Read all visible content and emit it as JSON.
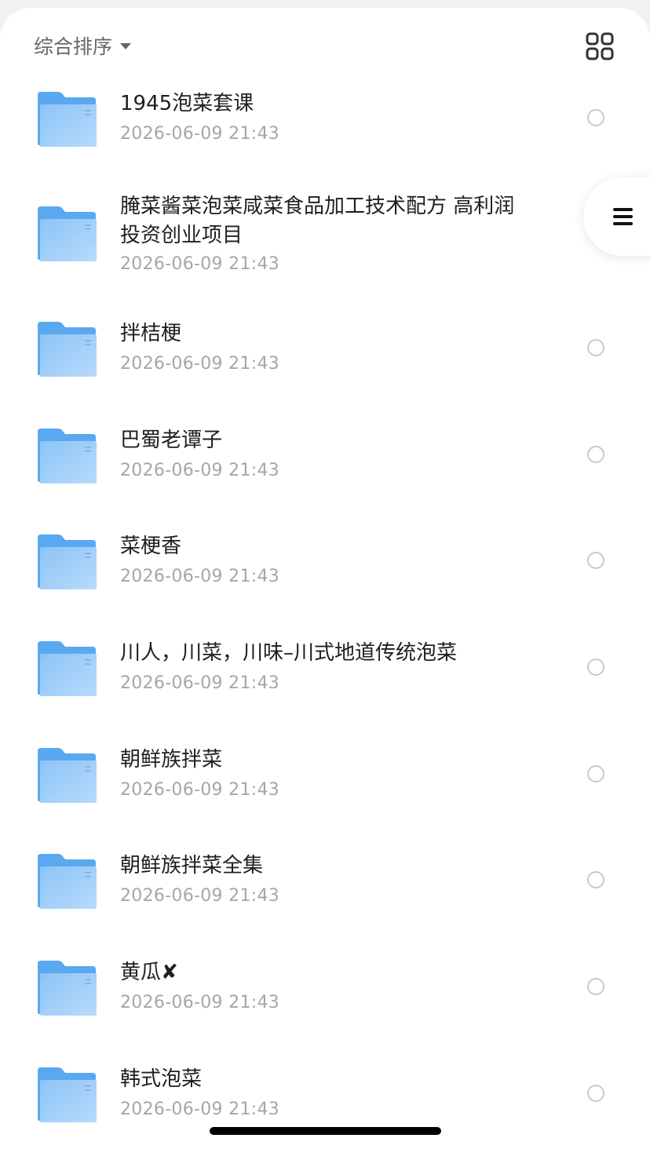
{
  "toolbar": {
    "sort_label": "综合排序",
    "sort_icon": "caret-down-icon",
    "view_toggle_icon": "grid-view-icon"
  },
  "files": [
    {
      "name": "1945泡菜套课",
      "date": "2026-06-09 21:43"
    },
    {
      "name": "腌菜酱菜泡菜咸菜食品加工技术配方 高利润投资创业项目",
      "date": "2026-06-09 21:43"
    },
    {
      "name": "拌桔梗",
      "date": "2026-06-09 21:43"
    },
    {
      "name": "巴蜀老谭子",
      "date": "2026-06-09 21:43"
    },
    {
      "name": "菜梗香",
      "date": "2026-06-09 21:43"
    },
    {
      "name": "川人，川菜，川味–川式地道传统泡菜",
      "date": "2026-06-09 21:43"
    },
    {
      "name": "朝鲜族拌菜",
      "date": "2026-06-09 21:43"
    },
    {
      "name": "朝鲜族拌菜全集",
      "date": "2026-06-09 21:43"
    },
    {
      "name": "黄瓜✘",
      "date": "2026-06-09 21:43"
    },
    {
      "name": "韩式泡菜",
      "date": "2026-06-09 21:43"
    }
  ],
  "side_menu": {
    "icon": "menu-icon"
  },
  "colors": {
    "folder": "#6ab0f2",
    "folder_light": "#b4d8fb"
  }
}
